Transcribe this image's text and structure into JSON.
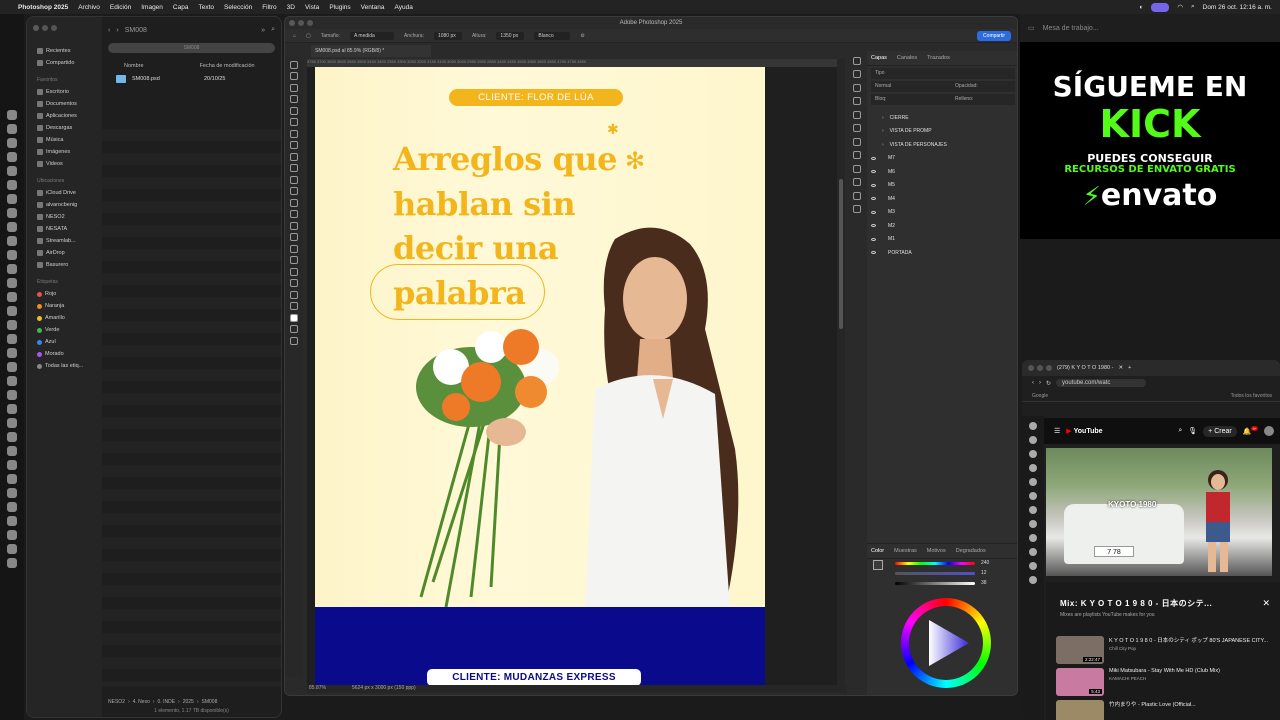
{
  "menubar": {
    "app": "Photoshop 2025",
    "items": [
      "Archivo",
      "Edición",
      "Imagen",
      "Capa",
      "Texto",
      "Selección",
      "Filtro",
      "3D",
      "Vista",
      "Plugins",
      "Ventana",
      "Ayuda"
    ],
    "clock": "Dom 26 oct.  12:16 a. m."
  },
  "finder": {
    "folder": "SM008",
    "search": "SM008",
    "favorites_label": "Favoritos",
    "sidebar_top": [
      "Recientes",
      "Compartido"
    ],
    "favorites": [
      "Escritorio",
      "Documentos",
      "Aplicaciones",
      "Descargas",
      "Música",
      "Imágenes",
      "Videos"
    ],
    "locations_label": "Ubicaciones",
    "locations": [
      "iCloud Drive",
      "alvarocbenig",
      "NESO2",
      "NESATA",
      "Streamlab...",
      "AirDrop",
      "Basurero"
    ],
    "tags_label": "Etiquetas",
    "tags": [
      {
        "name": "Rojo",
        "color": "#e5534b"
      },
      {
        "name": "Naranja",
        "color": "#f08a24"
      },
      {
        "name": "Amarillo",
        "color": "#e8c12a"
      },
      {
        "name": "Verde",
        "color": "#3fb950"
      },
      {
        "name": "Azul",
        "color": "#3b82f6"
      },
      {
        "name": "Morado",
        "color": "#a855f7"
      },
      {
        "name": "Todas las etiq...",
        "color": "#888888"
      }
    ],
    "col_name": "Nombre",
    "col_date": "Fecha de modificación",
    "file_name": "SM008.psd",
    "file_date": "20/10/25",
    "path": [
      "NESO2",
      "4. Neso",
      "0. INDE",
      "2025",
      "SM008"
    ],
    "status": "1 elemento, 1.17 TB disponible(s)"
  },
  "photoshop": {
    "window_title": "Adobe Photoshop 2025",
    "doc_tab": "SM008.psd al 85.9% (RGB/8) *",
    "options": {
      "size_label": "Tamaño:",
      "size_value": "A medida",
      "width_label": "Anchura:",
      "width_value": "1080 px",
      "height_label": "Altura:",
      "height_value": "1350 px",
      "bg_value": "Blanco"
    },
    "share": "Compartir",
    "zoom": "85.87%",
    "docsize": "5624 px x 3000 px (150 ppp)",
    "ruler": "3750  3700  3650  3600  3550  3500  3450  3400  3350  3300  3250  3200  3150  3100  3050  3000  2950  2900  2850  4400  4450  4500  4550  4600  4650  4700  4750  4800",
    "canvas": {
      "client_pill_1": "CLIENTE: FLOR DE LÚA",
      "headline": [
        "Arreglos que",
        "hablan sin",
        "decir una",
        "palabra"
      ],
      "client_pill_2": "CLIENTE: MUDANZAS EXPRESS",
      "accent": "#f2b51c",
      "bg2": "#0a0a8c"
    },
    "layers_panel": {
      "tabs": [
        "Capas",
        "Canales",
        "Trazados"
      ],
      "search": "Tipo",
      "blend": "Normal",
      "opacity_label": "Opacidad:",
      "fill_label": "Relleno:",
      "lock_label": "Bloq:",
      "groups": [
        "CIERRE",
        "VISTA DE PROMP",
        "VISTA DE PERSONAJES"
      ],
      "layers": [
        "M7",
        "M6",
        "M5",
        "M4",
        "M3",
        "M2",
        "M1",
        "PORTADA"
      ]
    },
    "color_panel": {
      "tabs": [
        "Color",
        "Muestras",
        "Motivos",
        "Degradados"
      ],
      "h": "240",
      "s": "12",
      "b": "38"
    }
  },
  "kick": {
    "line1": "SÍGUEME EN",
    "line2": "KICK",
    "line3": "PUEDES CONSEGUIR",
    "line4": "RECURSOS DE ENVATO GRATIS",
    "envato": "envato"
  },
  "mesa": "Mesa de trabajo...",
  "youtube": {
    "tab_title": "(279) K Y O T O  1980 -",
    "url": "youtube.com/watc",
    "bookmark1": "Google",
    "bookmark2": "Todos los favoritos",
    "logo": "YouTube",
    "create": "Crear",
    "notif": "9+",
    "video_title": "KYOTO 1980",
    "plate": "7 78",
    "mix_title": "Mix: K Y O T O  1 9 8 0 - 日本のシテ...",
    "mix_sub": "Mixes are playlists YouTube makes for you",
    "queue": [
      {
        "title": "K Y O T O  1 9 8 0 - 日本のシティ ポップ 80'S JAPANESE CITY...",
        "channel": "Chill City Pop",
        "time": "2:22:47",
        "color": "#7c6e64"
      },
      {
        "title": "Miki Matsubara - Stay With Me HD (Club Mix)",
        "channel": "KAMACHI PEACH",
        "time": "5:43",
        "color": "#c87aa0"
      },
      {
        "title": "竹内まりや - Plastic Love (Official...",
        "channel": "",
        "time": "",
        "color": "#9c8a66"
      }
    ]
  }
}
